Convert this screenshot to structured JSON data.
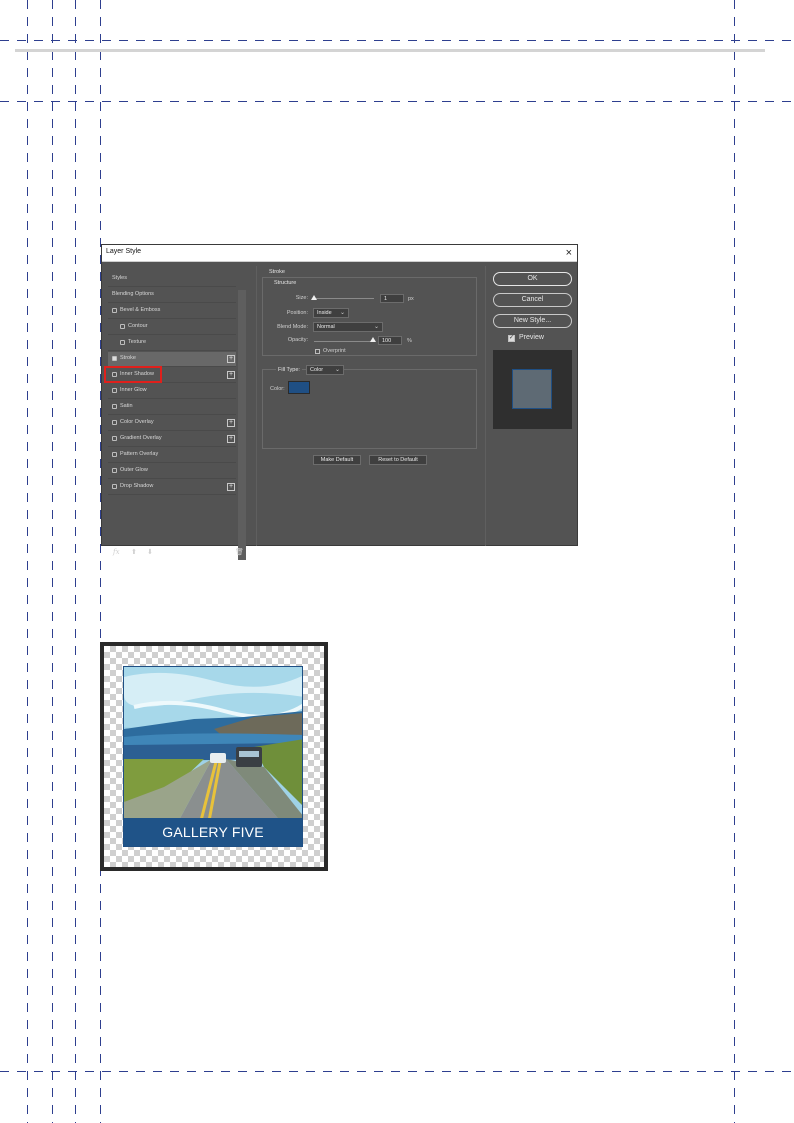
{
  "dialog": {
    "title": "Layer Style",
    "close_glyph": "×",
    "sidebar": {
      "styles_label": "Styles",
      "blending_options_label": "Blending Options",
      "items": [
        {
          "label": "Bevel & Emboss",
          "checked": false,
          "has_add": false
        },
        {
          "label": "Contour",
          "checked": false,
          "has_add": false
        },
        {
          "label": "Texture",
          "checked": false,
          "has_add": false
        },
        {
          "label": "Stroke",
          "checked": true,
          "has_add": true
        },
        {
          "label": "Inner Shadow",
          "checked": false,
          "has_add": true
        },
        {
          "label": "Inner Glow",
          "checked": false,
          "has_add": false
        },
        {
          "label": "Satin",
          "checked": false,
          "has_add": false
        },
        {
          "label": "Color Overlay",
          "checked": false,
          "has_add": true
        },
        {
          "label": "Gradient Overlay",
          "checked": false,
          "has_add": true
        },
        {
          "label": "Pattern Overlay",
          "checked": false,
          "has_add": false
        },
        {
          "label": "Outer Glow",
          "checked": false,
          "has_add": false
        },
        {
          "label": "Drop Shadow",
          "checked": false,
          "has_add": true
        }
      ],
      "footer_icons": [
        "fx-icon",
        "move-up-icon",
        "move-down-icon",
        "trash-icon"
      ],
      "fx_glyph": "fx",
      "up_glyph": "⬆",
      "down_glyph": "⬇",
      "trash_glyph": "🗑",
      "plus_glyph": "+"
    },
    "stroke": {
      "section_title": "Stroke",
      "structure_title": "Structure",
      "size_label": "Size:",
      "size_value": "1",
      "size_unit": "px",
      "position_label": "Position:",
      "position_value": "Inside",
      "blend_mode_label": "Blend Mode:",
      "blend_mode_value": "Normal",
      "opacity_label": "Opacity:",
      "opacity_value": "100",
      "opacity_unit": "%",
      "overprint_label": "Overprint",
      "fill_type_label": "Fill Type:",
      "fill_type_value": "Color",
      "color_label": "Color:",
      "color_hex": "#1f4f84",
      "make_default_label": "Make Default",
      "reset_default_label": "Reset to Default",
      "caret_glyph": "⌄"
    },
    "buttons": {
      "ok": "OK",
      "cancel": "Cancel",
      "new_style": "New Style...",
      "preview_label": "Preview",
      "preview_checked": true,
      "check_glyph": "✓"
    }
  },
  "gallery": {
    "caption": "GALLERY FIVE",
    "stroke_color": "#1f4f84",
    "banner_color": "#1f5388"
  },
  "colors": {
    "highlight": "#e0201c",
    "dialog_bg": "#535353"
  }
}
